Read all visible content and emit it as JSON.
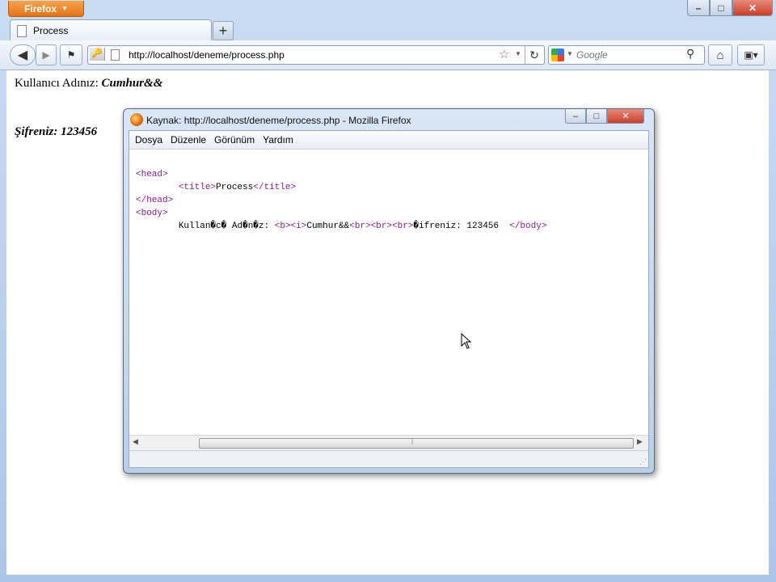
{
  "browser": {
    "app_button": "Firefox",
    "tab_title": "Process",
    "new_tab_label": "+",
    "url": "http://localhost/deneme/process.php",
    "search_placeholder": "Google"
  },
  "page": {
    "line1_label": "Kullanıcı Adınız: ",
    "line1_value": "Cumhur&&",
    "line2": "Şifreniz: 123456"
  },
  "source_window": {
    "title": "Kaynak: http://localhost/deneme/process.php - Mozilla Firefox",
    "menu": [
      "Dosya",
      "Düzenle",
      "Görünüm",
      "Yardım"
    ],
    "source_lines": {
      "l1_tag": "<head>",
      "l2_open": "<title>",
      "l2_text": "Process",
      "l2_close": "</title>",
      "l3_tag": "</head>",
      "l4_tag": "<body>",
      "l5_text_a": "Kullan�c� Ad�n�z: ",
      "l5_b": "<b>",
      "l5_i": "<i>",
      "l5_text_b": "Cumhur&&",
      "l5_br1": "<br>",
      "l5_br2": "<br>",
      "l5_br3": "<br>",
      "l5_text_c": "�ifreniz: 123456  ",
      "l5_endbody": "</body>"
    }
  },
  "icons": [
    "back-icon",
    "forward-icon",
    "reload-icon",
    "home-icon",
    "bookmark-star-icon",
    "search-icon",
    "firefox-logo-icon",
    "mouse-cursor-icon"
  ]
}
